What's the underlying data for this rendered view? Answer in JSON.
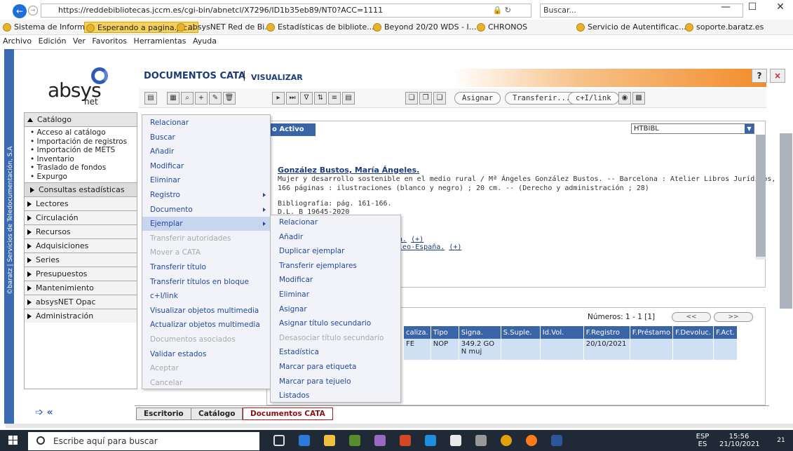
{
  "browser": {
    "url": "https://reddebibliotecas.jccm.es/cgi-bin/abnetcl/X7296/ID1b35eb89/NT0?ACC=1111",
    "search_placeholder": "Buscar...",
    "favorites": [
      "Sistema de Informació...",
      "Esperando a pagina.jcc...",
      "absysNET Red de Bi...",
      "Estadísticas de bibliote...",
      "Beyond 20/20 WDS - I...",
      "CHRONOS",
      "Servicio de Autentificac...",
      "soporte.baratz.es"
    ],
    "menu": [
      "Archivo",
      "Edición",
      "Ver",
      "Favoritos",
      "Herramientas",
      "Ayuda"
    ]
  },
  "app": {
    "vertical_text": "©baratz | Servicios de Teledocumentación, S.A",
    "logo": "absys",
    "logo_sub": "net",
    "header_title": "DOCUMENTOS CATA",
    "header_sep": "|",
    "header_action": "VISUALIZAR",
    "help": "?",
    "close": "×"
  },
  "leftnav": {
    "catalog": "Catálogo",
    "catalog_items": [
      "Acceso al catálogo",
      "Importación de registros",
      "Importación de METS",
      "Inventario",
      "Traslado de fondos",
      "Expurgo"
    ],
    "consultas": "Consultas estadísticas",
    "sections": [
      "Lectores",
      "Circulación",
      "Recursos",
      "Adquisiciones",
      "Series",
      "Presupuestos",
      "Mantenimiento",
      "absysNET Opac",
      "Administración"
    ]
  },
  "toolbar": {
    "assign": "Asignar",
    "transfer": "Transferir...",
    "link": "c+I/link"
  },
  "record": {
    "tab": "o Activo",
    "select_value": "HTBIBL",
    "author": "González Bustos, María Ángeles.",
    "line1": "Mujer y desarrollo sostenible en el medio rural / Mª Ángeles González Bustos. -- Barcelona : Atelier Libros Jurídicos, [2020]",
    "line2": "166 páginas : ilustraciones (blanco y negro) ; 20 cm. -- (Derecho y administración ; 28)",
    "line3": "Bibliografía: pág. 161-166.",
    "line4": "D.L. B 19645-2020",
    "subj1": "aña.",
    "subj1_plus": "(+)",
    "subj2": "mpleo-España.",
    "subj2_plus": "(+)"
  },
  "copies": {
    "numeros": "Números: 1 - 1 [1]",
    "prev": "<<",
    "next": ">>",
    "headers": [
      "caliza.",
      "Tipo",
      "Signa.",
      "S.Suple.",
      "Id.Vol.",
      "F.Registro",
      "F.Préstamo",
      "F.Devoluc.",
      "F.Act."
    ],
    "row": [
      "FE",
      "NOP",
      "349.2 GO N muj",
      "",
      "",
      "20/10/2021",
      "",
      "",
      ""
    ]
  },
  "menu1": [
    {
      "label": "Relacionar",
      "enabled": true
    },
    {
      "label": "Buscar",
      "enabled": true
    },
    {
      "label": "Añadir",
      "enabled": true
    },
    {
      "label": "Modificar",
      "enabled": true
    },
    {
      "label": "Eliminar",
      "enabled": true
    },
    {
      "label": "Registro",
      "enabled": true,
      "submenu": true
    },
    {
      "label": "Documento",
      "enabled": true,
      "submenu": true
    },
    {
      "label": "Ejemplar",
      "enabled": true,
      "submenu": true,
      "highlighted": true
    },
    {
      "label": "Transferir autoridades",
      "enabled": false
    },
    {
      "label": "Mover a CATA",
      "enabled": false
    },
    {
      "label": "Transferir título",
      "enabled": true
    },
    {
      "label": "Transferir títulos en bloque",
      "enabled": true
    },
    {
      "label": "c+I/link",
      "enabled": true
    },
    {
      "label": "Visualizar objetos multimedia",
      "enabled": true
    },
    {
      "label": "Actualizar objetos multimedia",
      "enabled": true
    },
    {
      "label": "Documentos asociados",
      "enabled": false
    },
    {
      "label": "Validar estados",
      "enabled": true
    },
    {
      "label": "Aceptar",
      "enabled": false
    },
    {
      "label": "Cancelar",
      "enabled": false
    }
  ],
  "menu2": [
    {
      "label": "Relacionar",
      "enabled": true
    },
    {
      "label": "Añadir",
      "enabled": true
    },
    {
      "label": "Duplicar ejemplar",
      "enabled": true
    },
    {
      "label": "Transferir ejemplares",
      "enabled": true
    },
    {
      "label": "Modificar",
      "enabled": true
    },
    {
      "label": "Eliminar",
      "enabled": true
    },
    {
      "label": "Asignar",
      "enabled": true
    },
    {
      "label": "Asignar título secundario",
      "enabled": true
    },
    {
      "label": "Desasociar título secundario",
      "enabled": false
    },
    {
      "label": "Estadística",
      "enabled": true
    },
    {
      "label": "Marcar para etiqueta",
      "enabled": true
    },
    {
      "label": "Marcar para tejuelo",
      "enabled": true
    },
    {
      "label": "Listados",
      "enabled": true
    }
  ],
  "bottom_tabs": [
    "Escritorio",
    "Catálogo",
    "Documentos CATA"
  ],
  "taskbar": {
    "search": "Escribe aquí para buscar",
    "lang": "ESP",
    "lang2": "ES",
    "time": "15:56",
    "date": "21/10/2021",
    "badge": "21"
  }
}
